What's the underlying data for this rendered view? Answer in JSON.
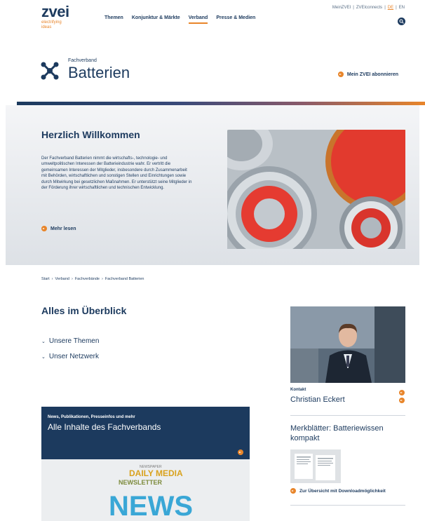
{
  "logo": {
    "word": "zvei",
    "tagline_line1": "electrifying",
    "tagline_line2": "ideas"
  },
  "nav": {
    "items": [
      "Themen",
      "Konjunktur & Märkte",
      "Verband",
      "Presse & Medien"
    ],
    "active_index": 2
  },
  "util_nav": {
    "mein": "MeinZVEI",
    "connects": "ZVEIconnects",
    "lang_de": "DE",
    "sep": "|",
    "lang_en": "EN"
  },
  "page": {
    "kicker": "Fachverband",
    "title": "Batterien",
    "subscribe": "Mein ZVEI abonnieren"
  },
  "hero": {
    "title": "Herzlich Willkommen",
    "text": "Der Fachverband Batterien nimmt die wirtschafts-, technologie- und umweltpolitischen Interessen der Batterieindustrie wahr. Er vertritt die gemeinsamen Interessen der Mitglieder, insbesondere durch Zusammenarbeit mit Behörden, wirtschaftlichen und sonstigen Stellen und Einrichtungen sowie durch Mitwirkung bei gesetzlichen Maßnahmen. Er unterstützt seine Mitglieder in der Förderung ihrer wirtschaftlichen und technischen Entwicklung.",
    "more": "Mehr lesen"
  },
  "breadcrumb": [
    "Start",
    "Verband",
    "Fachverbände",
    "Fachverband Batterien"
  ],
  "overview": {
    "title": "Alles im Überblick",
    "items": [
      "Unsere Themen",
      "Unser Netzwerk"
    ]
  },
  "news_card": {
    "small": "News, Publikationen, Presseinfos und mehr",
    "big": "Alle Inhalte des Fachverbands",
    "img_words": [
      "NEWSPAPER",
      "DAILY MEDIA",
      "NEWSLETTER",
      "NEWS"
    ]
  },
  "contact": {
    "label": "Kontakt",
    "name": "Christian Eckert"
  },
  "merkblatt": {
    "title": "Merkblätter: Batteriewissen kompakt",
    "link": "Zur Übersicht mit Downloadmöglichkeit"
  },
  "colors": {
    "navy": "#1c3a5e",
    "orange": "#e8852a"
  }
}
